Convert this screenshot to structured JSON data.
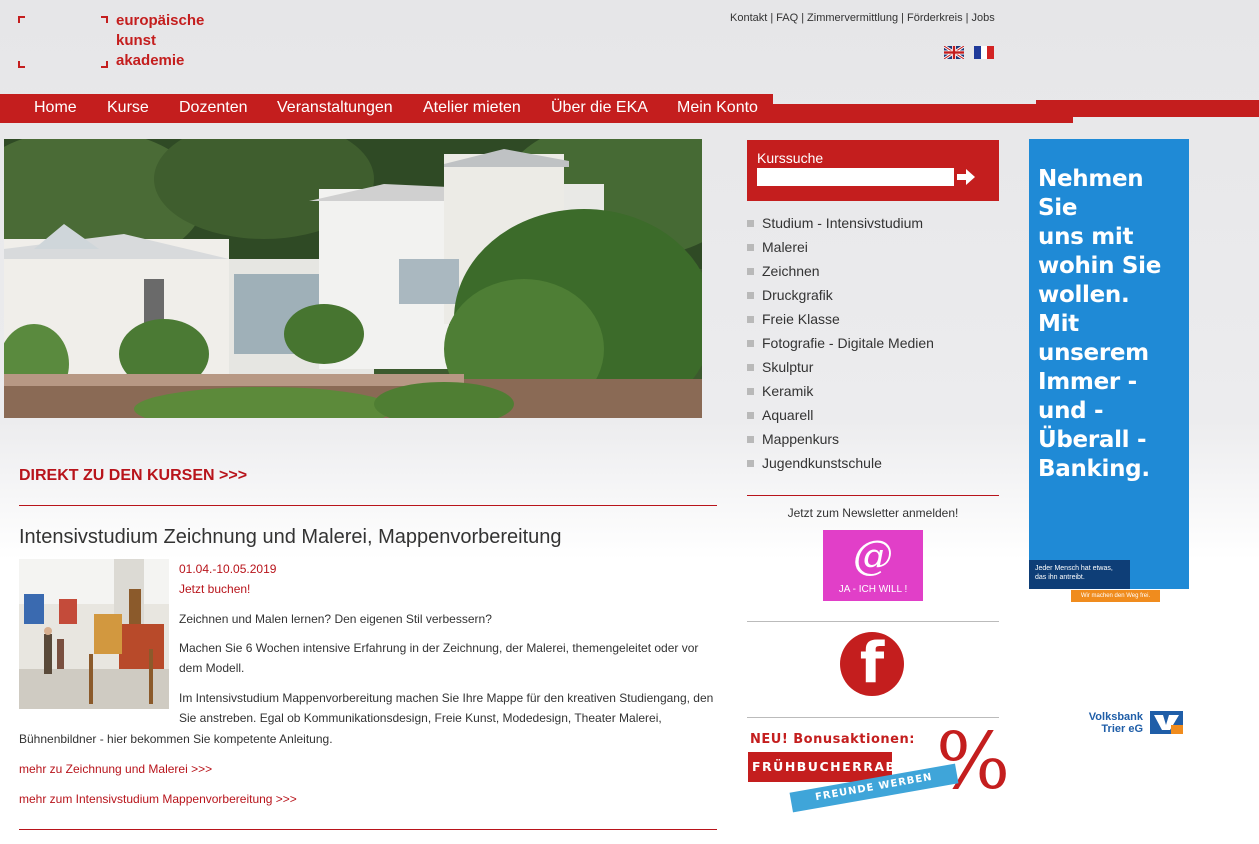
{
  "logo": {
    "line1": "europäische",
    "line2": "kunst",
    "line3": "akademie"
  },
  "toplinks": [
    "Kontakt",
    "FAQ",
    "Zimmervermittlung",
    "Förderkreis",
    "Jobs"
  ],
  "nav": [
    "Home",
    "Kurse",
    "Dozenten",
    "Veranstaltungen",
    "Atelier mieten",
    "Über die EKA",
    "Mein Konto"
  ],
  "direkt_link": "DIREKT ZU DEN KURSEN >>>",
  "article": {
    "title": "Intensivstudium Zeichnung und Malerei, Mappenvorbereitung",
    "date": "01.04.-10.05.2019",
    "book": "Jetzt buchen!",
    "p1": "Zeichnen und Malen lernen? Den eigenen Stil verbessern?",
    "p2_line1": "Machen Sie 6 Wochen intensive Erfahrung in der Zeichnung, der Malerei, themengeleitet oder vor",
    "p2_line2": "dem Modell.",
    "p3_line1": "Im Intensivstudium Mappenvorbereitung machen Sie Ihre Mappe für den kreativen Studiengang, den",
    "p3_line2": "Sie anstreben. Egal ob Kommunikationsdesign, Freie Kunst, Modedesign, Theater Malerei,",
    "p3_line3": "Bühnenbildner - hier bekommen Sie kompetente Anleitung.",
    "more1": "mehr zu Zeichnung und Malerei >>>",
    "more2": "mehr zum Intensivstudium Mappenvorbereitung >>>"
  },
  "sidebar": {
    "search_label": "Kurssuche",
    "search_value": "",
    "categories": [
      "Studium - Intensivstudium",
      "Malerei",
      "Zeichnen",
      "Druckgrafik",
      "Freie Klasse",
      "Fotografie - Digitale Medien",
      "Skulptur",
      "Keramik",
      "Aquarell",
      "Mappenkurs",
      "Jugendkunstschule"
    ],
    "newsletter_text": "Jetzt zum Newsletter anmelden!",
    "newsletter_button_symbol": "@",
    "newsletter_button_label": "JA - ICH WILL !",
    "facebook_letter": "f",
    "bonus_title": "NEU! Bonusaktionen:",
    "bonus_red": "FRÜHBUCHERRABATT",
    "bonus_blue": "FREUNDE WERBEN FREUNDE",
    "bonus_percent": "%"
  },
  "ad": {
    "headline_lines": [
      "Nehmen Sie",
      "uns mit",
      "wohin Sie",
      "wollen.",
      "Mit unserem",
      "Immer -",
      "und -",
      "Überall -",
      "Banking."
    ],
    "small_line1": "Jeder Mensch hat etwas,",
    "small_line2": "das ihn antreibt.",
    "orange_text": "Wir machen den Weg frei.",
    "bank_line1": "Volksbank",
    "bank_line2": "Trier eG"
  },
  "colors": {
    "brand_red": "#c41e1e",
    "link_red": "#b8141b",
    "ad_blue": "#1f8ad6",
    "newsletter_pink": "#e13fc8"
  }
}
